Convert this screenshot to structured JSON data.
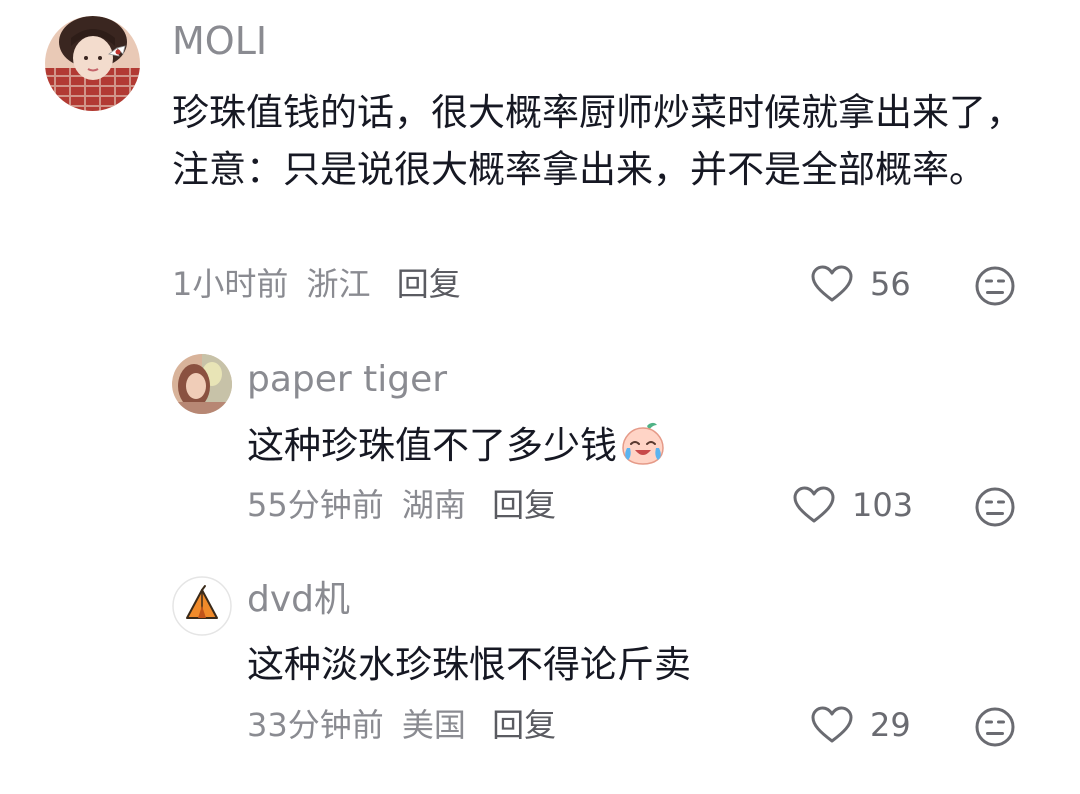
{
  "comments": [
    {
      "username": "MOLI",
      "content": "珍珠值钱的话，很大概率厨师炒菜时候就拿出来了，注意：只是说很大概率拿出来，并不是全部概率。",
      "time": "1小时前",
      "location": "浙江",
      "reply_label": "回复",
      "likes": "56",
      "avatar_icon": "avatar-girl-photo"
    },
    {
      "username": "paper tiger",
      "content": "这种珍珠值不了多少钱",
      "content_emoji": "crying-laughing-peach-emoji",
      "time": "55分钟前",
      "location": "湖南",
      "reply_label": "回复",
      "likes": "103",
      "avatar_icon": "avatar-photo"
    },
    {
      "username": "dvd机",
      "content": "这种淡水珍珠恨不得论斤卖",
      "time": "33分钟前",
      "location": "美国",
      "reply_label": "回复",
      "likes": "29",
      "avatar_icon": "tent-icon"
    }
  ],
  "icons": {
    "like": "heart-outline-icon",
    "dislike": "meh-face-icon"
  },
  "colors": {
    "text": "#161823",
    "meta": "#8a8b91",
    "icon": "#6a6b71"
  }
}
